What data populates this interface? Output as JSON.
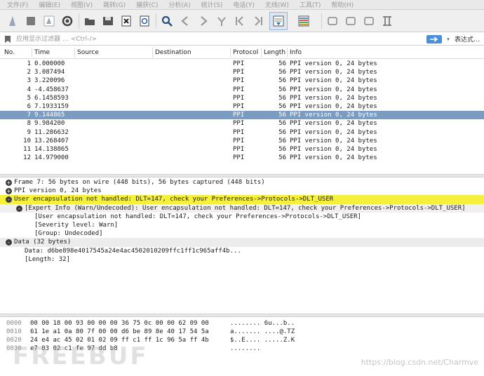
{
  "menu": [
    "文件(F)",
    "编辑(E)",
    "视图(V)",
    "跳转(G)",
    "捕获(C)",
    "分析(A)",
    "统计(S)",
    "电话(Y)",
    "无线(W)",
    "工具(T)",
    "帮助(H)"
  ],
  "filter": {
    "placeholder": "应用显示过滤器 … <Ctrl-/>",
    "expression_label": "表达式…"
  },
  "columns": {
    "no": "No.",
    "time": "Time",
    "source": "Source",
    "destination": "Destination",
    "protocol": "Protocol",
    "length": "Length",
    "info": "Info"
  },
  "packets": [
    {
      "no": "1",
      "time": "0.000000",
      "source": "",
      "destination": "",
      "protocol": "PPI",
      "length": "56",
      "info": "PPI version 0, 24 bytes"
    },
    {
      "no": "2",
      "time": "3.087494",
      "source": "",
      "destination": "",
      "protocol": "PPI",
      "length": "56",
      "info": "PPI version 0, 24 bytes"
    },
    {
      "no": "3",
      "time": "3.220096",
      "source": "",
      "destination": "",
      "protocol": "PPI",
      "length": "56",
      "info": "PPI version 0, 24 bytes"
    },
    {
      "no": "4",
      "time": "-4.458637",
      "source": "",
      "destination": "",
      "protocol": "PPI",
      "length": "56",
      "info": "PPI version 0, 24 bytes"
    },
    {
      "no": "5",
      "time": "6.1458593",
      "source": "",
      "destination": "",
      "protocol": "PPI",
      "length": "56",
      "info": "PPI version 0, 24 bytes"
    },
    {
      "no": "6",
      "time": "7.1933159",
      "source": "",
      "destination": "",
      "protocol": "PPI",
      "length": "56",
      "info": "PPI version 0, 24 bytes"
    },
    {
      "no": "7",
      "time": "9.144865",
      "source": "",
      "destination": "",
      "protocol": "PPI",
      "length": "56",
      "info": "PPI version 0, 24 bytes"
    },
    {
      "no": "8",
      "time": "9.984200",
      "source": "",
      "destination": "",
      "protocol": "PPI",
      "length": "56",
      "info": "PPI version 0, 24 bytes"
    },
    {
      "no": "9",
      "time": "11.286632",
      "source": "",
      "destination": "",
      "protocol": "PPI",
      "length": "56",
      "info": "PPI version 0, 24 bytes"
    },
    {
      "no": "10",
      "time": "13.268407",
      "source": "",
      "destination": "",
      "protocol": "PPI",
      "length": "56",
      "info": "PPI version 0, 24 bytes"
    },
    {
      "no": "11",
      "time": "14.138865",
      "source": "",
      "destination": "",
      "protocol": "PPI",
      "length": "56",
      "info": "PPI version 0, 24 bytes"
    },
    {
      "no": "12",
      "time": "14.979000",
      "source": "",
      "destination": "",
      "protocol": "PPI",
      "length": "56",
      "info": "PPI version 0, 24 bytes"
    }
  ],
  "selected_packet": "7",
  "details": [
    {
      "text": "Frame 7: 56 bytes on wire (448 bits), 56 bytes captured (448 bits)",
      "toggle": "+",
      "level": 0,
      "style": "normal"
    },
    {
      "text": "PPI version 0, 24 bytes",
      "toggle": "+",
      "level": 0,
      "style": "normal"
    },
    {
      "text": "User encapsulation not handled: DLT=147, check your Preferences->Protocols->DLT_USER",
      "toggle": "-",
      "level": 0,
      "style": "warn"
    },
    {
      "text": "[Expert Info (Warn/Undecoded): User encapsulation not handled: DLT=147, check your Preferences->Protocols->DLT_USER]",
      "toggle": "-",
      "level": 1,
      "style": "sub"
    },
    {
      "text": "[User encapsulation not handled: DLT=147, check your Preferences->Protocols->DLT_USER]",
      "toggle": "",
      "level": 2,
      "style": "normal"
    },
    {
      "text": "[Severity level: Warn]",
      "toggle": "",
      "level": 2,
      "style": "normal"
    },
    {
      "text": "[Group: Undecoded]",
      "toggle": "",
      "level": 2,
      "style": "normal"
    },
    {
      "text": "Data (32 bytes)",
      "toggle": "-",
      "level": 0,
      "style": "grey"
    },
    {
      "text": "Data: d6be898e4017545a24e4ac4502010209ffc1ff1c965aff4b...",
      "toggle": "",
      "level": 1,
      "style": "normal"
    },
    {
      "text": "[Length: 32]",
      "toggle": "",
      "level": 1,
      "style": "normal"
    }
  ],
  "bytes": [
    {
      "offset": "0000",
      "hex": "00 00 18 00 93 00 00 00  36 75 0c 00 00 62 09 00",
      "ascii": "........ 6u...b.."
    },
    {
      "offset": "0010",
      "hex": "61 1e a1 0a 80 7f 00 00  d6 be 89 8e 40 17 54 5a",
      "ascii": "a....... ....@.TZ"
    },
    {
      "offset": "0020",
      "hex": "24 e4 ac 45 02 01 02 09  ff c1 ff 1c 96 5a ff 4b",
      "ascii": "$..E.... .....Z.K"
    },
    {
      "offset": "0030",
      "hex": "e7 03 02 c1 fe 97 dd b8",
      "ascii": "........"
    }
  ],
  "watermark": {
    "logo": "FREEBUF",
    "url": "https://blog.csdn.net/Charmve"
  },
  "colors": {
    "selected_row": "#7a9cc0",
    "warn_row": "#f5f03c",
    "apply_button": "#4a8fd4"
  },
  "toolbar_icons": [
    "shark-fin-icon",
    "stop-icon",
    "restart-icon",
    "options-gear-icon",
    "open-file-icon",
    "save-icon",
    "close-file-icon",
    "reload-icon",
    "find-icon",
    "go-back-icon",
    "go-forward-icon",
    "go-to-packet-icon",
    "first-packet-icon",
    "last-packet-icon",
    "autoscroll-icon",
    "colorize-icon",
    "zoom-in-icon",
    "zoom-out-icon",
    "normal-size-icon",
    "resize-columns-icon"
  ]
}
